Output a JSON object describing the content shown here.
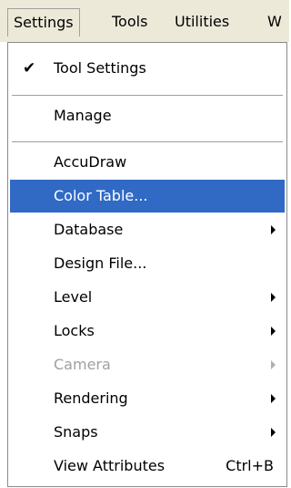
{
  "menubar": {
    "items": [
      {
        "label": "Settings"
      },
      {
        "label": "Tools"
      },
      {
        "label": "Utilities"
      },
      {
        "label": "W"
      }
    ]
  },
  "menu": {
    "items": [
      {
        "label": "Tool Settings",
        "checked": true
      },
      {
        "label": "Manage"
      },
      {
        "label": "AccuDraw"
      },
      {
        "label": "Color Table...",
        "highlighted": true
      },
      {
        "label": "Database",
        "submenu": true
      },
      {
        "label": "Design File..."
      },
      {
        "label": "Level",
        "submenu": true
      },
      {
        "label": "Locks",
        "submenu": true
      },
      {
        "label": "Camera",
        "submenu": true,
        "disabled": true
      },
      {
        "label": "Rendering",
        "submenu": true
      },
      {
        "label": "Snaps",
        "submenu": true
      },
      {
        "label": "View Attributes",
        "shortcut": "Ctrl+B"
      }
    ]
  },
  "colors": {
    "highlight": "#316ac5",
    "menubar_bg": "#ece9d8",
    "disabled_text": "#a0a0a0"
  }
}
